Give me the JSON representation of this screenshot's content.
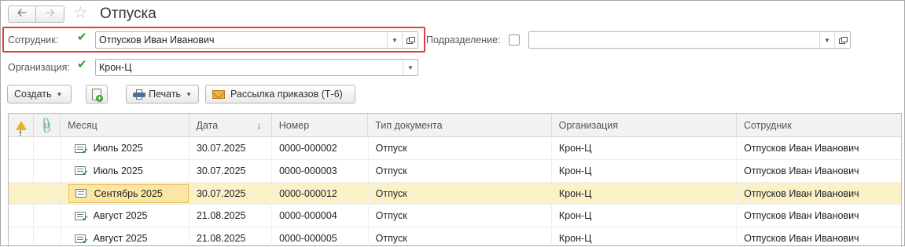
{
  "window": {
    "title": "Отпуска"
  },
  "filters": {
    "employee": {
      "label": "Сотрудник:",
      "checked": true,
      "value": "Отпусков Иван Иванович"
    },
    "department": {
      "label": "Подразделение:",
      "checked": false,
      "value": ""
    },
    "organization": {
      "label": "Организация:",
      "checked": true,
      "value": "Крон-Ц"
    }
  },
  "toolbar": {
    "create_label": "Создать",
    "print_label": "Печать",
    "mailing_label": "Рассылка приказов (Т-6)"
  },
  "table": {
    "columns": [
      "Месяц",
      "Дата",
      "Номер",
      "Тип документа",
      "Организация",
      "Сотрудник"
    ],
    "sort_column": "Дата",
    "rows": [
      {
        "month": "Июль 2025",
        "date": "30.07.2025",
        "number": "0000-000002",
        "doc_type": "Отпуск",
        "organization": "Крон-Ц",
        "employee": "Отпусков Иван Иванович",
        "posted": true
      },
      {
        "month": "Июль 2025",
        "date": "30.07.2025",
        "number": "0000-000003",
        "doc_type": "Отпуск",
        "organization": "Крон-Ц",
        "employee": "Отпусков Иван Иванович",
        "posted": true
      },
      {
        "month": "Сентябрь 2025",
        "date": "30.07.2025",
        "number": "0000-000012",
        "doc_type": "Отпуск",
        "organization": "Крон-Ц",
        "employee": "Отпусков Иван Иванович",
        "posted": false,
        "selected": true
      },
      {
        "month": "Август 2025",
        "date": "21.08.2025",
        "number": "0000-000004",
        "doc_type": "Отпуск",
        "organization": "Крон-Ц",
        "employee": "Отпусков Иван Иванович",
        "posted": true
      },
      {
        "month": "Август 2025",
        "date": "21.08.2025",
        "number": "0000-000005",
        "doc_type": "Отпуск",
        "organization": "Крон-Ц",
        "employee": "Отпусков Иван Иванович",
        "posted": true
      }
    ]
  },
  "colors": {
    "selected_row": "#fbf1c8",
    "selected_cell": "#fbe6a6",
    "highlight_frame": "#e0403c",
    "check_green": "#2f9a2f"
  },
  "icons": {
    "back": "arrow-left-icon",
    "forward": "arrow-right-icon",
    "favorite": "star-icon",
    "open": "open-in-window-icon",
    "dropdown": "chevron-down-icon",
    "create_copy": "document-add-icon",
    "print": "printer-icon",
    "mailing": "envelope-icon",
    "warning": "warning-icon",
    "attachment": "paperclip-icon",
    "row_doc": "document-posted-icon"
  }
}
